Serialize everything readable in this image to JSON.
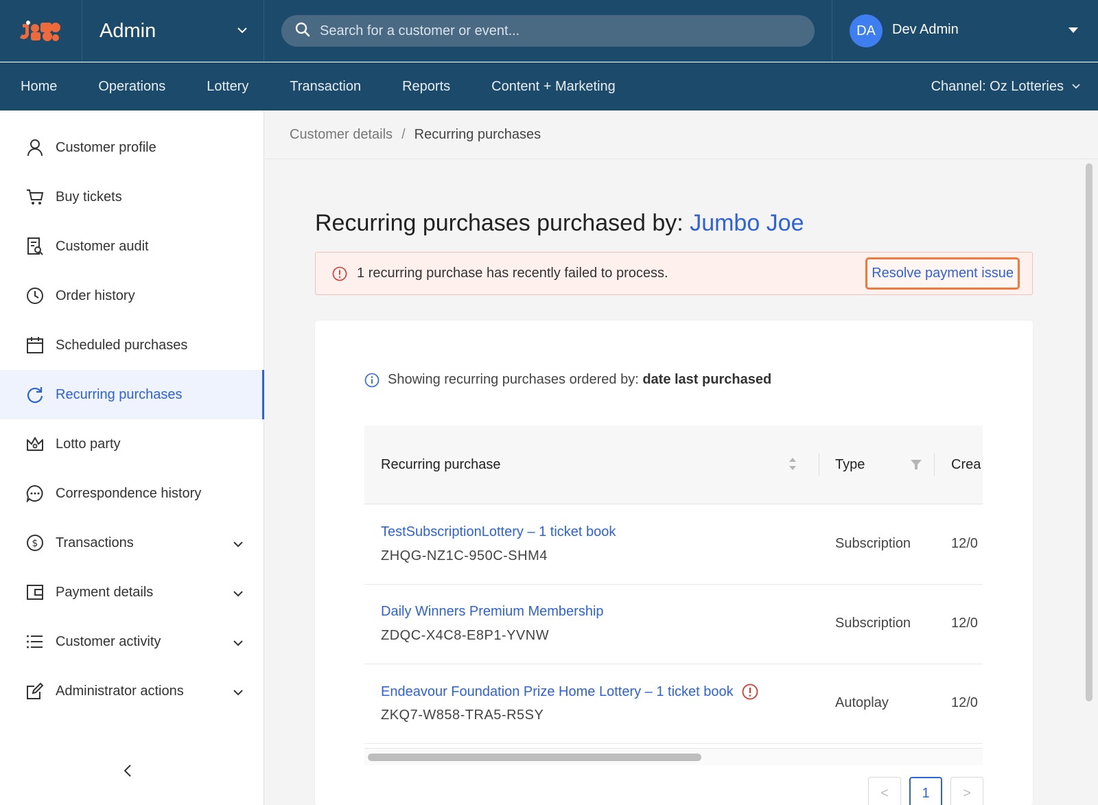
{
  "header": {
    "app_title": "Admin",
    "search_placeholder": "Search for a customer or event...",
    "user_initials": "DA",
    "user_name": "Dev Admin"
  },
  "nav": {
    "items": [
      "Home",
      "Operations",
      "Lottery",
      "Transaction",
      "Reports",
      "Content + Marketing"
    ],
    "channel": "Channel: Oz Lotteries"
  },
  "sidebar": {
    "items": [
      {
        "label": "Customer profile",
        "icon": "user-icon"
      },
      {
        "label": "Buy tickets",
        "icon": "cart-icon"
      },
      {
        "label": "Customer audit",
        "icon": "audit-icon"
      },
      {
        "label": "Order history",
        "icon": "clock-icon"
      },
      {
        "label": "Scheduled purchases",
        "icon": "calendar-icon"
      },
      {
        "label": "Recurring purchases",
        "icon": "refresh-icon",
        "active": true
      },
      {
        "label": "Lotto party",
        "icon": "crown-icon"
      },
      {
        "label": "Correspondence history",
        "icon": "chat-icon"
      },
      {
        "label": "Transactions",
        "icon": "dollar-icon",
        "expandable": true
      },
      {
        "label": "Payment details",
        "icon": "wallet-icon",
        "expandable": true
      },
      {
        "label": "Customer activity",
        "icon": "list-icon",
        "expandable": true
      },
      {
        "label": "Administrator actions",
        "icon": "edit-icon",
        "expandable": true
      }
    ]
  },
  "breadcrumb": {
    "parent": "Customer details",
    "separator": "/",
    "current": "Recurring purchases"
  },
  "page": {
    "title_prefix": "Recurring purchases purchased by: ",
    "customer_name": "Jumbo Joe"
  },
  "alert": {
    "message": "1 recurring purchase has recently failed to process.",
    "action": "Resolve payment issue"
  },
  "info": {
    "prefix": "Showing recurring purchases ordered by: ",
    "order_by": "date last purchased"
  },
  "table": {
    "columns": [
      "Recurring purchase",
      "Type",
      "Crea"
    ],
    "rows": [
      {
        "name": "TestSubscriptionLottery – 1 ticket book",
        "code": "ZHQG-NZ1C-950C-SHM4",
        "type": "Subscription",
        "created": "12/0",
        "failed": false
      },
      {
        "name": "Daily Winners Premium Membership",
        "code": "ZDQC-X4C8-E8P1-YVNW",
        "type": "Subscription",
        "created": "12/0",
        "failed": false
      },
      {
        "name": "Endeavour Foundation Prize Home Lottery – 1 ticket book",
        "code": "ZKQ7-W858-TRA5-R5SY",
        "type": "Autoplay",
        "created": "12/0",
        "failed": true
      }
    ]
  },
  "pagination": {
    "prev": "<",
    "current": "1",
    "next": ">"
  },
  "colors": {
    "header_bg": "#1c4a6a",
    "accent": "#2e62d9",
    "brand_orange": "#ef6a3a",
    "alert_bg": "#fdf0ed",
    "error_red": "#e0352b"
  }
}
